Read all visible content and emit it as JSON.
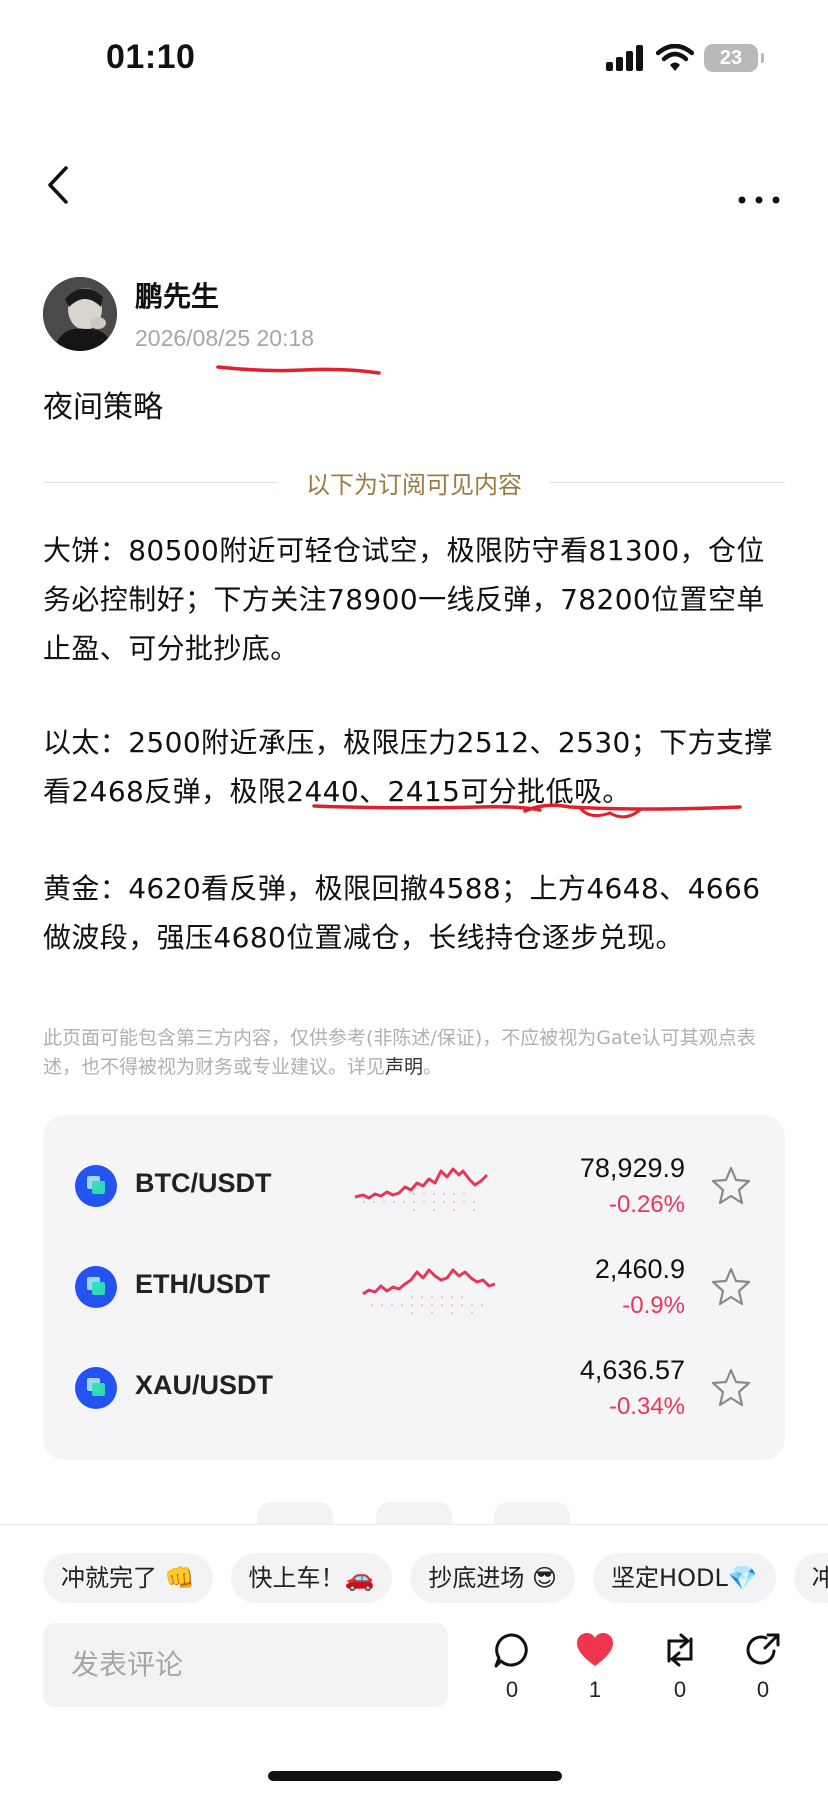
{
  "status_bar": {
    "time": "01:10",
    "battery": "23"
  },
  "author": {
    "name": "鹏先生",
    "timestamp": "2026/08/25 20:18"
  },
  "post": {
    "title": "夜间策略",
    "divider_label": "以下为订阅可见内容",
    "paragraphs": [
      "大饼：80500附近可轻仓试空，极限防守看81300，仓位务必控制好；下方关注78900一线反弹，78200位置空单止盈、可分批抄底。",
      "以太：2500附近承压，极限压力2512、2530；下方支撑看2468反弹，极限2440、2415可分批低吸。",
      "黄金：4620看反弹，极限回撤4588；上方4648、4666做波段，强压4680位置减仓，长线持仓逐步兑现。"
    ],
    "disclaimer": "此页面可能包含第三方内容，仅供参考(非陈述/保证)，不应被视为Gate认可其观点表述，也不得被视为财务或专业建议。详见",
    "disclaimer_link": "声明",
    "disclaimer_end": "。"
  },
  "markets": [
    {
      "pair": "BTC/USDT",
      "price": "78,929.9",
      "change": "-0.26%",
      "icon": "gate-coin-icon"
    },
    {
      "pair": "ETH/USDT",
      "price": "2,460.9",
      "change": "-0.9%",
      "icon": "gate-coin-icon"
    },
    {
      "pair": "XAU/USDT",
      "price": "4,636.57",
      "change": "-0.34%",
      "icon": "gate-coin-icon"
    }
  ],
  "quick_replies": [
    "冲就完了 👊",
    "快上车！🚗",
    "抄底进场 😎",
    "坚定HODL💎",
    "冲"
  ],
  "comment_placeholder": "发表评论",
  "actions": {
    "comments": "0",
    "likes": "1",
    "reposts": "0",
    "shares": "0"
  },
  "colors": {
    "accent_red": "#e8365a",
    "divider_gold": "#9c7a40",
    "annotation_red": "#e0212b",
    "coin_blue": "#2353f0"
  }
}
